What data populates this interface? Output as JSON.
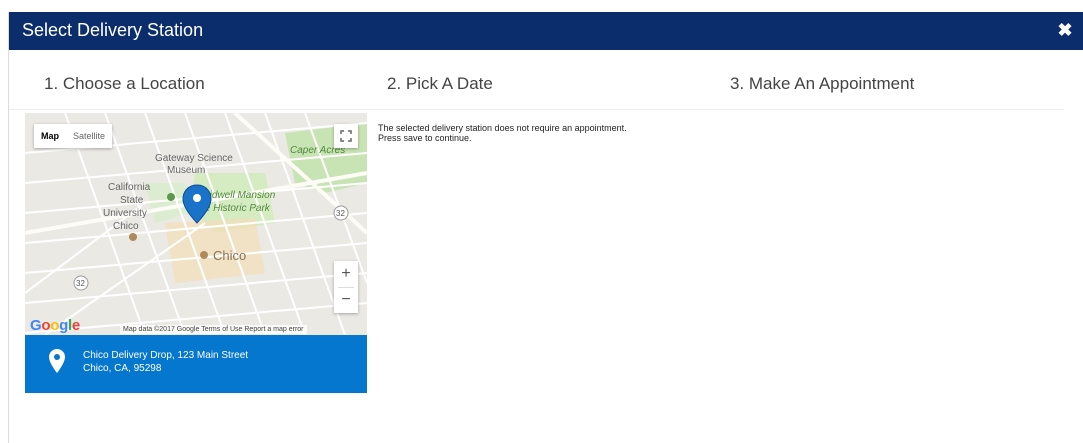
{
  "dialog": {
    "title": "Select Delivery Station",
    "close_icon": "close-icon"
  },
  "steps": [
    {
      "label": "1. Choose a Location"
    },
    {
      "label": "2. Pick A Date"
    },
    {
      "label": "3. Make An Appointment"
    }
  ],
  "map": {
    "type_options": [
      "Map",
      "Satellite"
    ],
    "selected_type": "Map",
    "zoom_in": "+",
    "zoom_out": "−",
    "labels": {
      "gateway1": "Gateway Science",
      "gateway2": "Museum",
      "caper": "Caper Acres",
      "california1": "California",
      "california2": "State",
      "california3": "University",
      "california4": "Chico",
      "bidwell1": "Bidwell Mansion",
      "bidwell2": "State Historic Park",
      "chico": "Chico",
      "route32": "32",
      "route32b": "32"
    },
    "google_logo": "Google",
    "attribution": "Map data ©2017 Google   Terms of Use   Report a map error"
  },
  "station": {
    "line1": "Chico Delivery Drop, 123 Main Street",
    "line2": "Chico, CA, 95298"
  },
  "message": {
    "line1": "The selected delivery station does not require an appointment.",
    "line2": "Press save to continue."
  }
}
